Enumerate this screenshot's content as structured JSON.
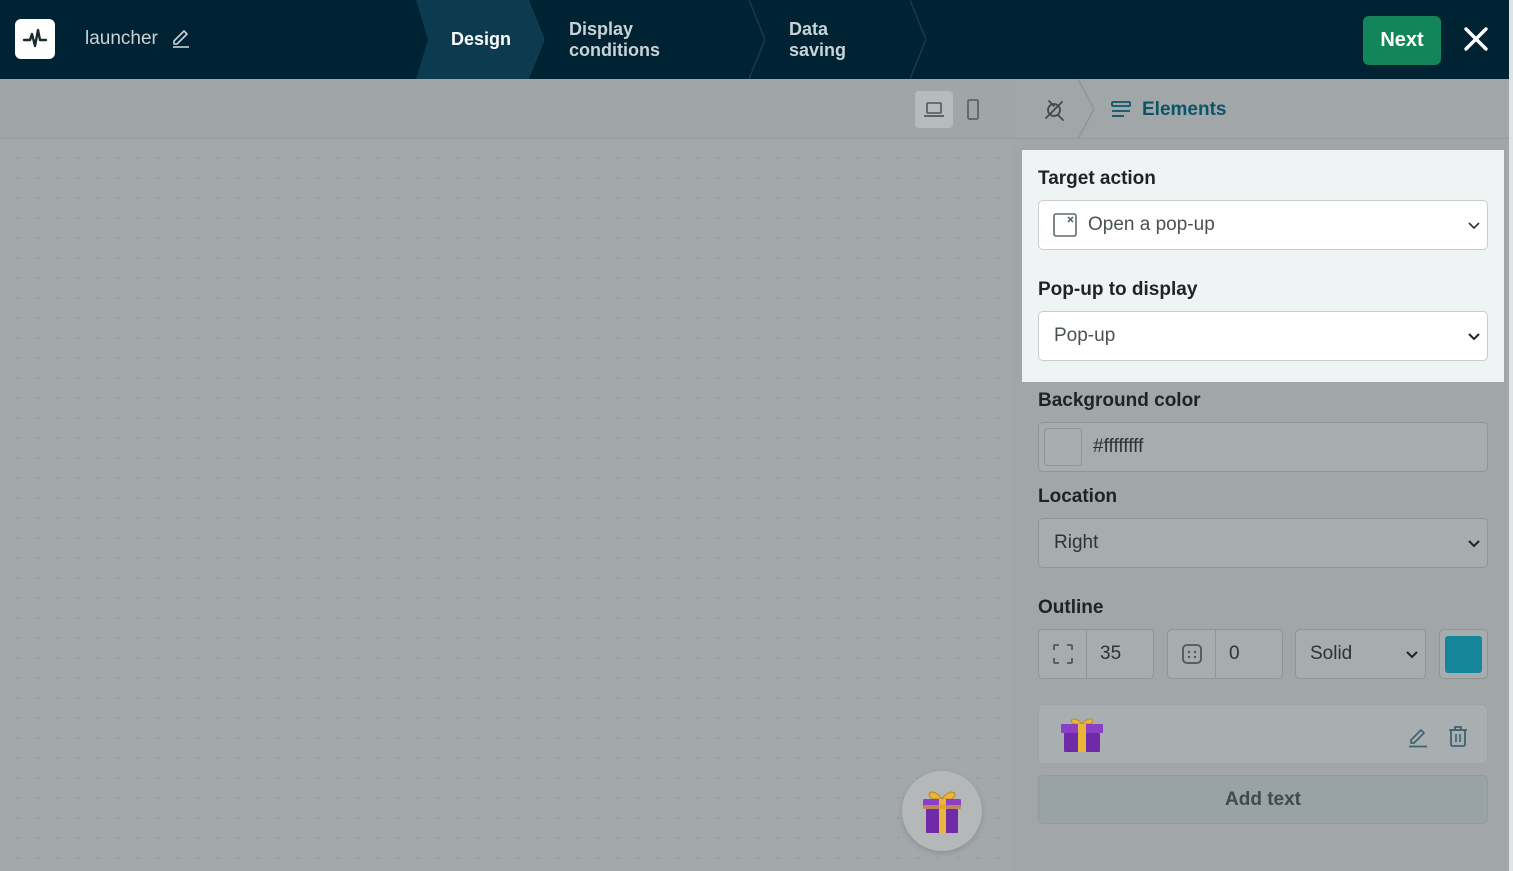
{
  "header": {
    "project_name": "launcher",
    "steps": [
      {
        "label": "Design",
        "active": true
      },
      {
        "label": "Display conditions",
        "active": false
      },
      {
        "label": "Data saving",
        "active": false
      }
    ],
    "next_label": "Next"
  },
  "canvas": {
    "devices": [
      "laptop-icon",
      "mobile-icon"
    ],
    "selected_device": "laptop"
  },
  "panel": {
    "breadcrumb_label": "Elements",
    "target_action": {
      "label": "Target action",
      "value": "Open a pop-up"
    },
    "popup_to_display": {
      "label": "Pop-up to display",
      "value": "Pop-up"
    },
    "background_color": {
      "label": "Background color",
      "value": "#ffffffff"
    },
    "location": {
      "label": "Location",
      "value": "Right"
    },
    "outline": {
      "label": "Outline",
      "size": "35",
      "radius": "0",
      "style": "Solid",
      "color": "#14869a"
    },
    "add_text_label": "Add text"
  },
  "colors": {
    "topbar": "#002333",
    "next_button": "#12865a",
    "accent": "#0b5568",
    "highlight_panel": "#f0f3f4"
  }
}
